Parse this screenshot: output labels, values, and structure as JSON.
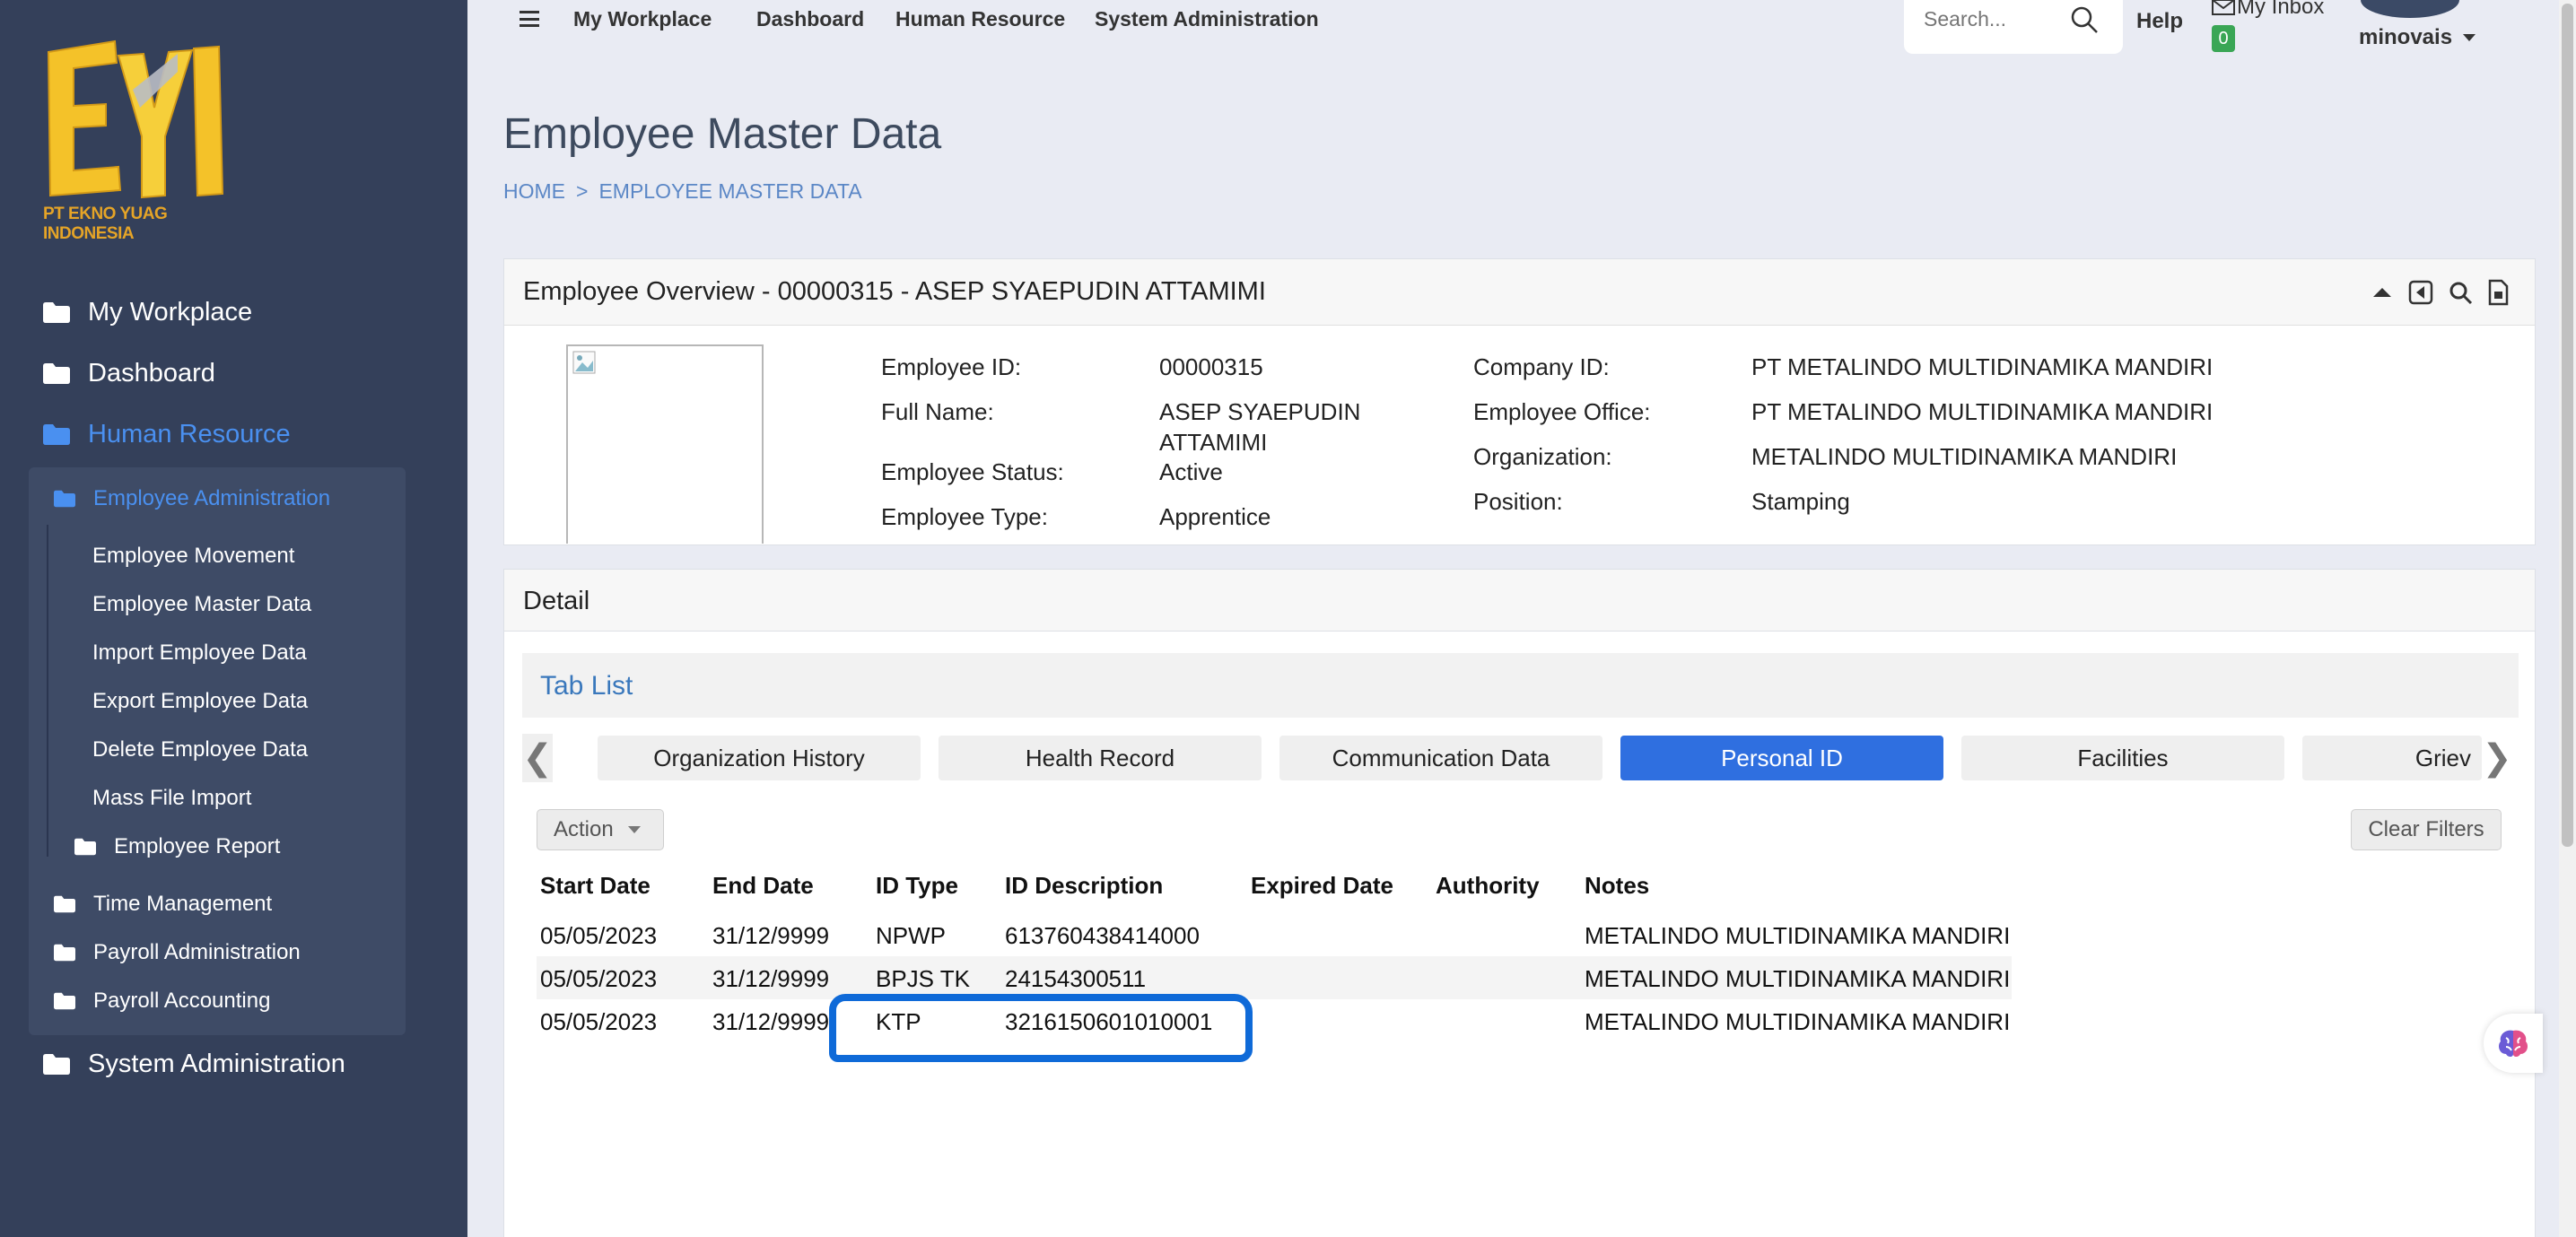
{
  "brand": {
    "logo_text": "EYI",
    "company_caption": "PT EKNO YUAG INDONESIA",
    "accent": "#e5a427"
  },
  "sidebar": {
    "items": [
      {
        "label": "My Workplace"
      },
      {
        "label": "Dashboard"
      },
      {
        "label": "Human Resource"
      },
      {
        "label": "System Administration"
      }
    ],
    "sub_items": [
      {
        "label": "Employee Administration"
      },
      {
        "label": "Employee Movement"
      },
      {
        "label": "Employee Master Data"
      },
      {
        "label": "Import Employee Data"
      },
      {
        "label": "Export Employee Data"
      },
      {
        "label": "Delete Employee Data"
      },
      {
        "label": "Mass File Import"
      },
      {
        "label": "Employee Report"
      },
      {
        "label": "Time Management"
      },
      {
        "label": "Payroll Administration"
      },
      {
        "label": "Payroll Accounting"
      }
    ]
  },
  "topbar": {
    "links": [
      "My Workplace",
      "Dashboard",
      "Human Resource",
      "System Administration"
    ],
    "search_placeholder": "Search...",
    "help": "Help",
    "inbox": "My Inbox",
    "inbox_count": "0",
    "username": "minovais"
  },
  "page": {
    "title": "Employee Master Data",
    "breadcrumb": [
      "HOME",
      ">",
      "EMPLOYEE MASTER DATA"
    ]
  },
  "overview": {
    "title": "Employee Overview - 00000315 - ASEP SYAEPUDIN ATTAMIMI",
    "fields": {
      "employee_id_label": "Employee ID:",
      "employee_id": "00000315",
      "full_name_label": "Full Name:",
      "full_name_line1": "ASEP SYAEPUDIN",
      "full_name_line2": "ATTAMIMI",
      "status_label": "Employee Status:",
      "status": "Active",
      "type_label": "Employee Type:",
      "type": "Apprentice",
      "company_label": "Company ID:",
      "company": "PT METALINDO MULTIDINAMIKA MANDIRI",
      "office_label": "Employee Office:",
      "office": "PT METALINDO MULTIDINAMIKA MANDIRI",
      "org_label": "Organization:",
      "org": "METALINDO MULTIDINAMIKA MANDIRI",
      "position_label": "Position:",
      "position": "Stamping"
    }
  },
  "detail": {
    "title": "Detail",
    "tablist_title": "Tab List",
    "tabs": [
      "Organization History",
      "Health Record",
      "Communication Data",
      "Personal ID",
      "Facilities",
      "Griev"
    ],
    "prev_arrow": "❮",
    "next_arrow": "❯",
    "action_label": "Action",
    "clear_filters_label": "Clear Filters",
    "table": {
      "headers": [
        "Start Date",
        "End Date",
        "ID Type",
        "ID Description",
        "Expired Date",
        "Authority",
        "Notes"
      ],
      "rows": [
        [
          "05/05/2023",
          "31/12/9999",
          "NPWP",
          "613760438414000",
          "",
          "",
          "METALINDO MULTIDINAMIKA MANDIRI"
        ],
        [
          "05/05/2023",
          "31/12/9999",
          "BPJS TK",
          "24154300511",
          "",
          "",
          "METALINDO MULTIDINAMIKA MANDIRI"
        ],
        [
          "05/05/2023",
          "31/12/9999",
          "KTP",
          "3216150601010001",
          "",
          "",
          "METALINDO MULTIDINAMIKA MANDIRI"
        ]
      ]
    }
  },
  "colors": {
    "sidebar_bg": "#34405a",
    "active_link": "#4a90f0",
    "tab_active": "#2f6fe0",
    "highlight": "#0f6ad8"
  }
}
